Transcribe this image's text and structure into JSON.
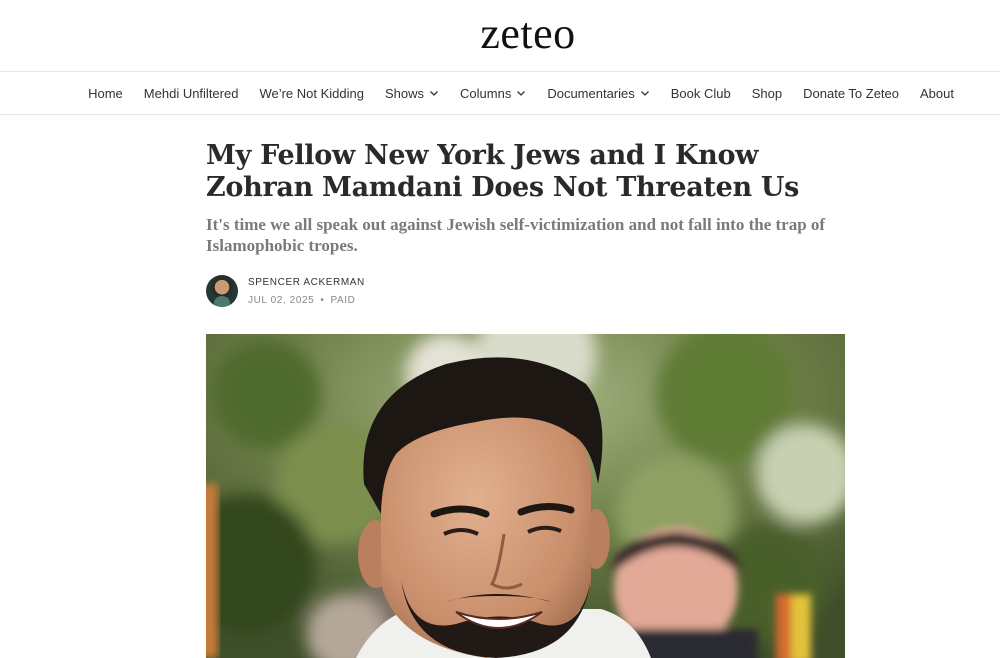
{
  "site": {
    "logo": "zeteo"
  },
  "nav": {
    "items": [
      {
        "label": "Home",
        "has_menu": false
      },
      {
        "label": "Mehdi Unfiltered",
        "has_menu": false
      },
      {
        "label": "We’re Not Kidding",
        "has_menu": false
      },
      {
        "label": "Shows",
        "has_menu": true
      },
      {
        "label": "Columns",
        "has_menu": true
      },
      {
        "label": "Documentaries",
        "has_menu": true
      },
      {
        "label": "Book Club",
        "has_menu": false
      },
      {
        "label": "Shop",
        "has_menu": false
      },
      {
        "label": "Donate To Zeteo",
        "has_menu": false
      },
      {
        "label": "About",
        "has_menu": false
      }
    ]
  },
  "article": {
    "title": "My Fellow New York Jews and I Know Zohran Mamdani Does Not Threaten Us",
    "subtitle": "It's time we all speak out against Jewish self-victimization and not fall into the trap of Islamophobic tropes.",
    "author": "SPENCER ACKERMAN",
    "date": "JUL 02, 2025",
    "separator": "•",
    "access": "PAID",
    "hero_image": "photo of smiling bearded man outdoors with green trees behind"
  },
  "colors": {
    "text": "#2a2a2a",
    "muted": "#7a7a7a",
    "divider": "#e6e6e6"
  }
}
